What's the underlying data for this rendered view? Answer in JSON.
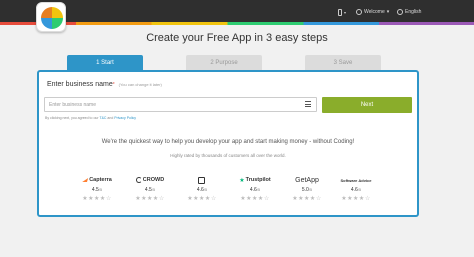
{
  "nav": {
    "welcome": "Welcome",
    "language": "English"
  },
  "headline": "Create your Free App in 3 easy steps",
  "tabs": [
    {
      "label": "1 Start"
    },
    {
      "label": "2 Purpose"
    },
    {
      "label": "3 Save"
    }
  ],
  "form": {
    "label": "Enter business name",
    "hint": "(You can change it later)",
    "placeholder": "Enter business name",
    "next_label": "Next",
    "agree_prefix": "By clicking next, you agreed to our",
    "tc_link": "T&C",
    "and": "and",
    "privacy_link": "Privacy Policy"
  },
  "promo": "We're the quickest way to help you develop your app and start making money - without Coding!",
  "rated": "Highly rated by thousands of customers all over the world.",
  "reviews": [
    {
      "brand": "Capterra",
      "score": "4.5",
      "outof": "/5"
    },
    {
      "brand": "CROWD",
      "score": "4.5",
      "outof": "/5"
    },
    {
      "brand": "",
      "score": "4.6",
      "outof": "/5"
    },
    {
      "brand": "Trustpilot",
      "score": "4.6",
      "outof": "/5"
    },
    {
      "brand": "GetApp",
      "score": "5.0",
      "outof": "/5"
    },
    {
      "brand": "Software Advice",
      "score": "4.6",
      "outof": "/5"
    }
  ],
  "stars": "★★★★☆",
  "colors": {
    "accent": "#2e95c8",
    "next_button": "#8aad2b",
    "topbar": "#2f2f2f"
  }
}
